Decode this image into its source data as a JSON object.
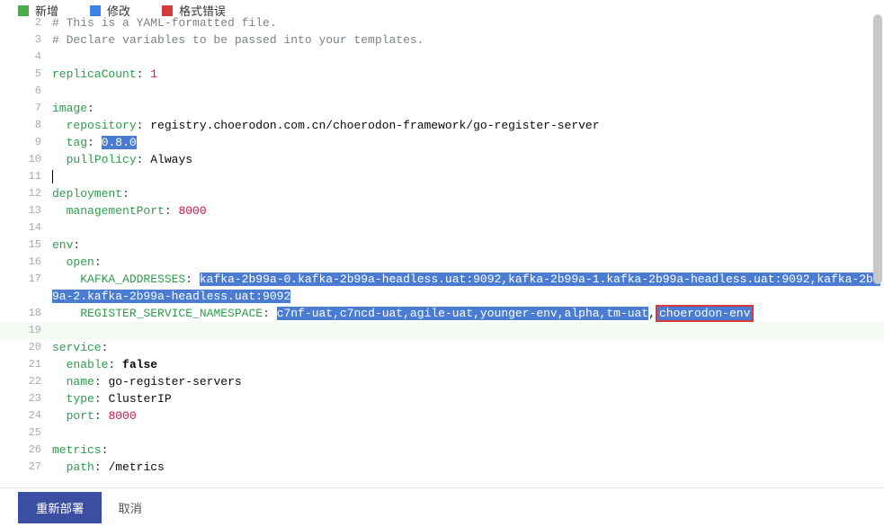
{
  "legend": {
    "add": "新增",
    "modify": "修改",
    "format_error": "格式错误"
  },
  "code": {
    "lines": [
      {
        "n": 2,
        "comment": "# This is a YAML-formatted file."
      },
      {
        "n": 3,
        "comment": "# Declare variables to be passed into your templates."
      },
      {
        "n": 4,
        "blank": true
      },
      {
        "n": 5,
        "key": "replicaCount",
        "val": "1",
        "vt": "num"
      },
      {
        "n": 6,
        "blank": true
      },
      {
        "n": 7,
        "key": "image",
        "val": ""
      },
      {
        "n": 8,
        "indent": 2,
        "key": "repository",
        "val": "registry.choerodon.com.cn/choerodon-framework/go-register-server",
        "vt": "str"
      },
      {
        "n": 9,
        "indent": 2,
        "key": "tag",
        "hl": "0.8.0"
      },
      {
        "n": 10,
        "indent": 2,
        "key": "pullPolicy",
        "val": "Always",
        "vt": "str"
      },
      {
        "n": 11,
        "cursor": true
      },
      {
        "n": 12,
        "key": "deployment",
        "val": ""
      },
      {
        "n": 13,
        "indent": 2,
        "key": "managementPort",
        "val": "8000",
        "vt": "num"
      },
      {
        "n": 14,
        "blank": true
      },
      {
        "n": 15,
        "key": "env",
        "val": ""
      },
      {
        "n": 16,
        "indent": 2,
        "key": "open",
        "val": ""
      },
      {
        "n": 17,
        "indent": 4,
        "key": "KAFKA_ADDRESSES",
        "hl": "kafka-2b99a-0.kafka-2b99a-headless.uat:9092,kafka-2b99a-1.kafka-2b99a-headless.uat:9092,kafka-2b99a-2.kafka-2b99a-headless.uat:9092",
        "wrap": true
      },
      {
        "n": 18,
        "indent": 4,
        "key": "REGISTER_SERVICE_NAMESPACE",
        "hl_a": "c7nf-uat,c7ncd-uat,agile-uat,younger-env,alpha,tm-uat",
        "hl_b": "choerodon-env"
      },
      {
        "n": 19,
        "rowhl": true
      },
      {
        "n": 20,
        "key": "service",
        "val": ""
      },
      {
        "n": 21,
        "indent": 2,
        "key": "enable",
        "val": "false",
        "vt": "false"
      },
      {
        "n": 22,
        "indent": 2,
        "key": "name",
        "val": "go-register-servers",
        "vt": "str"
      },
      {
        "n": 23,
        "indent": 2,
        "key": "type",
        "val": "ClusterIP",
        "vt": "str"
      },
      {
        "n": 24,
        "indent": 2,
        "key": "port",
        "val": "8000",
        "vt": "num"
      },
      {
        "n": 25,
        "blank": true
      },
      {
        "n": 26,
        "key": "metrics",
        "val": ""
      },
      {
        "n": 27,
        "indent": 2,
        "key": "path",
        "val": "/metrics",
        "vt": "str"
      }
    ]
  },
  "footer": {
    "redeploy": "重新部署",
    "cancel": "取消"
  }
}
